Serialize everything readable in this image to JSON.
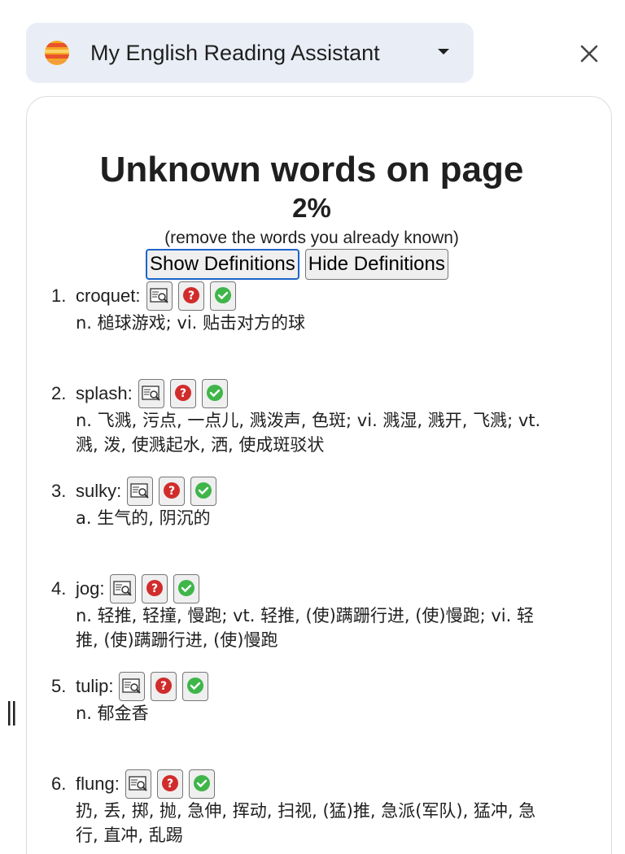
{
  "header": {
    "title": "My English Reading Assistant"
  },
  "panel": {
    "title": "Unknown words on page",
    "percent": "2%",
    "instruction": "(remove the words you already known)",
    "show_button": "Show Definitions",
    "hide_button": "Hide Definitions"
  },
  "words": [
    {
      "num": "1.",
      "word": "croquet:",
      "definition": "n. 槌球游戏; vi. 贴击对方的球"
    },
    {
      "num": "2.",
      "word": "splash:",
      "definition": "n. 飞溅, 污点, 一点儿, 溅泼声, 色斑; vi. 溅湿, 溅开, 飞溅; vt. 溅, 泼, 使溅起水, 洒, 使成斑驳状"
    },
    {
      "num": "3.",
      "word": "sulky:",
      "definition": "a. 生气的, 阴沉的"
    },
    {
      "num": "4.",
      "word": "jog:",
      "definition": "n. 轻推, 轻撞, 慢跑; vt. 轻推, (使)蹒跚行进, (使)慢跑; vi. 轻推, (使)蹒跚行进, (使)慢跑"
    },
    {
      "num": "5.",
      "word": "tulip:",
      "definition": "n. 郁金香"
    },
    {
      "num": "6.",
      "word": "flung:",
      "definition": "扔, 丢, 掷, 抛, 急伸, 挥动, 扫视, (猛)推, 急派(军队), 猛冲, 急行, 直冲, 乱踢"
    }
  ],
  "icons": {
    "logo": "planet-logo-icon",
    "dropdown": "chevron-down-icon",
    "close": "close-icon",
    "lookup": "dictionary-lookup-icon",
    "unknown": "question-mark-icon",
    "known": "check-mark-icon",
    "resize": "resize-handle-icon"
  },
  "colors": {
    "header_bg": "#e9eef6",
    "question_red": "#d12c2c",
    "check_green": "#3fb54a",
    "focus_blue": "#1d64c8"
  }
}
